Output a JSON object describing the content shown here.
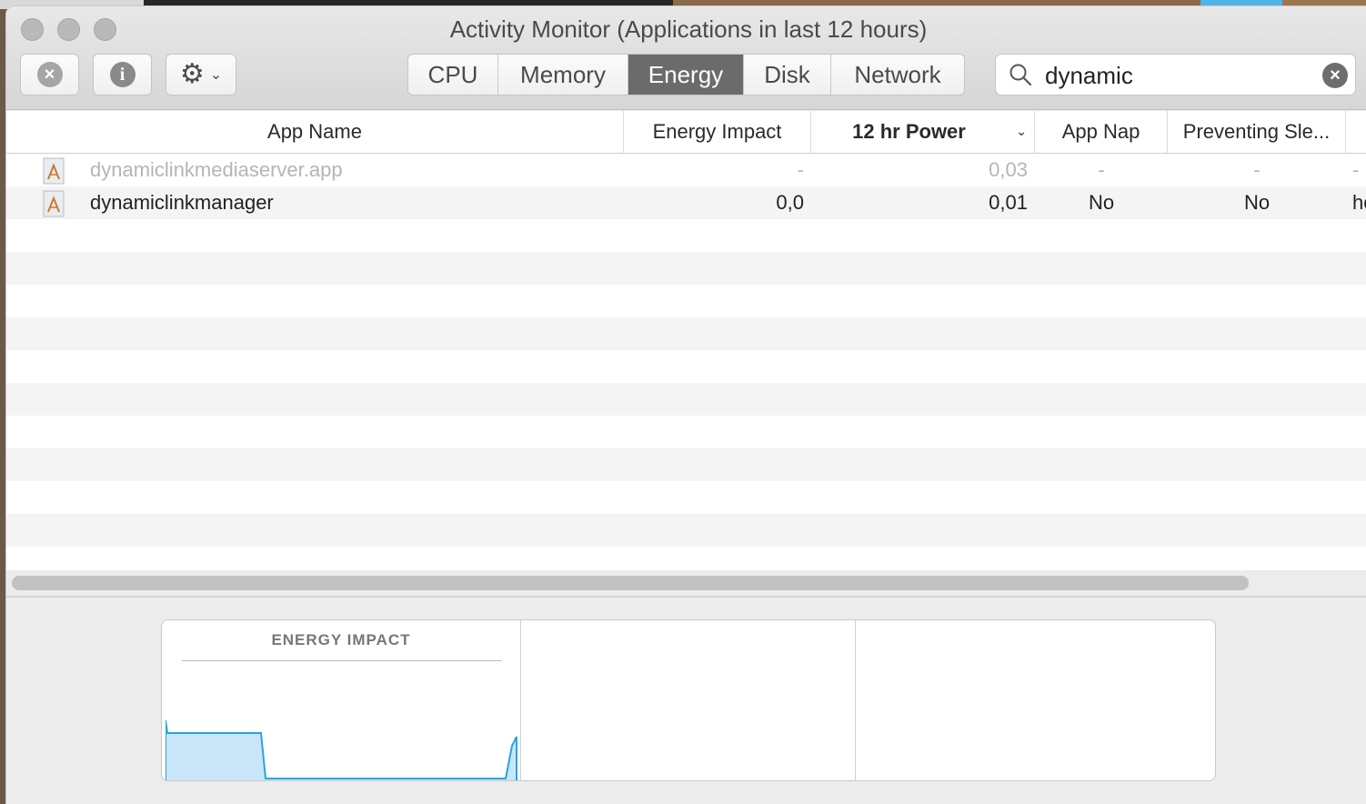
{
  "window": {
    "title": "Activity Monitor (Applications in last 12 hours)"
  },
  "toolbar": {
    "stop_icon": "close-x-icon",
    "info_icon": "info-icon",
    "gear_icon": "gear-icon",
    "tabs": [
      "CPU",
      "Memory",
      "Energy",
      "Disk",
      "Network"
    ],
    "active_tab": "Energy"
  },
  "search": {
    "value": "dynamic",
    "placeholder": "Search"
  },
  "table": {
    "columns": [
      "App Name",
      "Energy Impact",
      "12 hr Power",
      "App Nap",
      "Preventing Sle...",
      ""
    ],
    "sorted_column": "12 hr Power",
    "rows": [
      {
        "name": "dynamiclinkmediaserver.app",
        "energy_impact": "-",
        "power_12hr": "0,03",
        "app_nap": "-",
        "preventing_sleep": "-",
        "extra": "-",
        "dimmed": true
      },
      {
        "name": "dynamiclinkmanager",
        "energy_impact": "0,0",
        "power_12hr": "0,01",
        "app_nap": "No",
        "preventing_sleep": "No",
        "extra": "hc",
        "dimmed": false
      }
    ]
  },
  "bottom_panel": {
    "title": "ENERGY IMPACT"
  },
  "colors": {
    "accent_active_tab": "#6b6b6b",
    "graph_fill": "#c8e6f8",
    "graph_stroke": "#2aa4e0"
  }
}
